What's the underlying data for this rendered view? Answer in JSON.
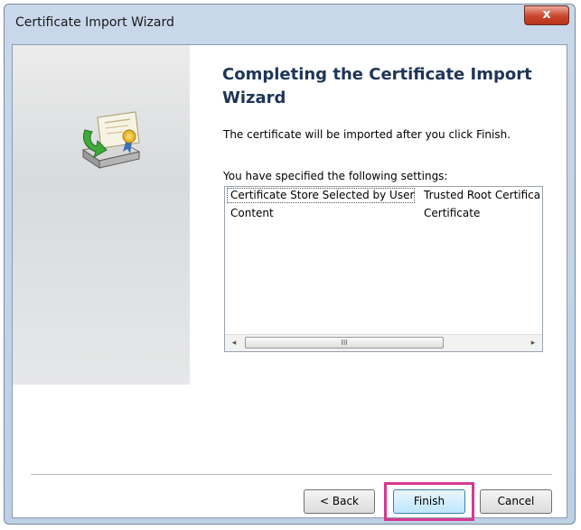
{
  "window": {
    "title": "Certificate Import Wizard",
    "close_glyph": "x"
  },
  "page": {
    "heading": "Completing the Certificate Import Wizard",
    "description": "The certificate will be imported after you click Finish.",
    "settings_label": "You have specified the following settings:"
  },
  "settings": [
    {
      "key": "Certificate Store Selected by User",
      "value": "Trusted Root Certifica"
    },
    {
      "key": "Content",
      "value": "Certificate"
    }
  ],
  "scrollbar": {
    "left_glyph": "◂",
    "right_glyph": "▸",
    "thumb_grip": "III"
  },
  "buttons": {
    "back": "< Back",
    "finish": "Finish",
    "cancel": "Cancel"
  },
  "colors": {
    "highlight": "#d63a8e",
    "heading": "#1d3557"
  },
  "icons": {
    "banner": "certificate-import-icon"
  }
}
